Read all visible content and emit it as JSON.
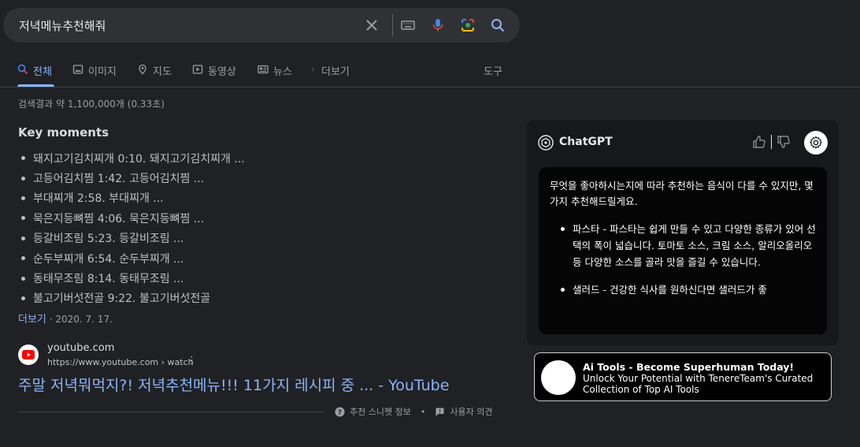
{
  "search": {
    "query": "저녁메뉴추천해줘"
  },
  "tabs": [
    {
      "label": "전체",
      "icon": "search-icon",
      "active": true
    },
    {
      "label": "이미지",
      "icon": "image-icon"
    },
    {
      "label": "지도",
      "icon": "map-pin-icon"
    },
    {
      "label": "동영상",
      "icon": "video-icon"
    },
    {
      "label": "뉴스",
      "icon": "news-icon"
    },
    {
      "label": "더보기",
      "icon": "more-vert-icon"
    }
  ],
  "tools_label": "도구",
  "result_stats": "검색결과 약 1,100,000개 (0.33초)",
  "key_moments": {
    "title": "Key moments",
    "items": [
      "돼지고기김치찌개 0:10. 돼지고기김치찌개 ...",
      "고등어김치찜 1:42. 고등어김치찜 ...",
      "부대찌개 2:58. 부대찌개 ...",
      "묵은지등뼈찜 4:06. 묵은지등뼈찜 ...",
      "등갈비조림 5:23. 등갈비조림 ...",
      "순두부찌개 6:54. 순두부찌개 ...",
      "동태무조림 8:14. 동태무조림 ...",
      "불고기버섯전골 9:22. 불고기버섯전골"
    ],
    "more_label": "더보기",
    "separator": "·",
    "date": "2020. 7. 17."
  },
  "result": {
    "site_name": "youtube.com",
    "url": "https://www.youtube.com › watch",
    "title": "주말 저녁뭐먹지?! 저녁추천메뉴!!! 11가지 레시피 중 ... - YouTube"
  },
  "snippet_footer": {
    "info_label": "추천 스니펫 정보",
    "separator": "•",
    "feedback_label": "사용자 의견"
  },
  "chatgpt": {
    "name": "ChatGPT",
    "intro": "무엇을 좋아하시는지에 따라 추천하는 음식이 다를 수 있지만, 몇 가지 추천해드릴게요.",
    "items": [
      "파스타 - 파스타는 쉽게 만들 수 있고 다양한 종류가 있어 선택의 폭이 넓습니다. 토마토 소스, 크림 소스, 알리오올리오 등 다양한 소스를 골라 맛을 즐길 수 있습니다.",
      "샐러드 - 건강한 식사를 원하신다면 샐러드가 좋"
    ]
  },
  "ad": {
    "title": "Ai Tools - Become Superhuman Today!",
    "description": "Unlock Your Potential with TenereTeam's Curated Collection of Top AI Tools"
  },
  "colors": {
    "background": "#202124",
    "link": "#8ab4f8",
    "text": "#bdc1c6"
  }
}
